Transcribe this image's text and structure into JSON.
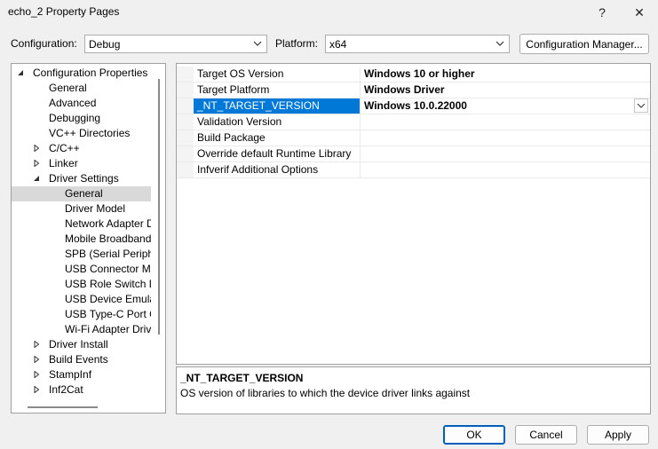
{
  "window": {
    "title": "echo_2 Property Pages",
    "help_glyph": "?",
    "close_glyph": "✕"
  },
  "config_bar": {
    "configuration_label": "Configuration:",
    "configuration_value": "Debug",
    "platform_label": "Platform:",
    "platform_value": "x64",
    "manager_button": "Configuration Manager..."
  },
  "tree": {
    "items": [
      {
        "label": "Configuration Properties",
        "indent": 1,
        "expander": "expanded"
      },
      {
        "label": "General",
        "indent": 2,
        "expander": "none"
      },
      {
        "label": "Advanced",
        "indent": 2,
        "expander": "none"
      },
      {
        "label": "Debugging",
        "indent": 2,
        "expander": "none"
      },
      {
        "label": "VC++ Directories",
        "indent": 2,
        "expander": "none"
      },
      {
        "label": "C/C++",
        "indent": 2,
        "expander": "collapsed"
      },
      {
        "label": "Linker",
        "indent": 2,
        "expander": "collapsed"
      },
      {
        "label": "Driver Settings",
        "indent": 2,
        "expander": "expanded"
      },
      {
        "label": "General",
        "indent": 3,
        "expander": "none",
        "selected": true
      },
      {
        "label": "Driver Model",
        "indent": 3,
        "expander": "none"
      },
      {
        "label": "Network Adapter Dr",
        "indent": 3,
        "expander": "none"
      },
      {
        "label": "Mobile Broadband A",
        "indent": 3,
        "expander": "none"
      },
      {
        "label": "SPB (Serial Peripher",
        "indent": 3,
        "expander": "none"
      },
      {
        "label": "USB Connector Mar",
        "indent": 3,
        "expander": "none"
      },
      {
        "label": "USB Role Switch Dri",
        "indent": 3,
        "expander": "none"
      },
      {
        "label": "USB Device Emulati",
        "indent": 3,
        "expander": "none"
      },
      {
        "label": "USB Type-C Port Cc",
        "indent": 3,
        "expander": "none"
      },
      {
        "label": "Wi-Fi Adapter Drive",
        "indent": 3,
        "expander": "none"
      },
      {
        "label": "Driver Install",
        "indent": 2,
        "expander": "collapsed"
      },
      {
        "label": "Build Events",
        "indent": 2,
        "expander": "collapsed"
      },
      {
        "label": "StampInf",
        "indent": 2,
        "expander": "collapsed"
      },
      {
        "label": "Inf2Cat",
        "indent": 2,
        "expander": "collapsed"
      }
    ]
  },
  "grid": {
    "rows": [
      {
        "name": "Target OS Version",
        "value": "Windows 10 or higher"
      },
      {
        "name": "Target Platform",
        "value": "Windows Driver"
      },
      {
        "name": "_NT_TARGET_VERSION",
        "value": "Windows 10.0.22000",
        "selected": true
      },
      {
        "name": "Validation Version",
        "value": ""
      },
      {
        "name": "Build Package",
        "value": ""
      },
      {
        "name": "Override default Runtime Library",
        "value": ""
      },
      {
        "name": "Infverif Additional Options",
        "value": ""
      }
    ]
  },
  "description": {
    "title": "_NT_TARGET_VERSION",
    "text": "OS version of libraries to which the device driver links against"
  },
  "footer": {
    "ok": "OK",
    "cancel": "Cancel",
    "apply": "Apply"
  },
  "colors": {
    "selection_blue": "#0078d7",
    "tree_selected": "#d9d9d9",
    "window_bg": "#f0f0f0"
  }
}
